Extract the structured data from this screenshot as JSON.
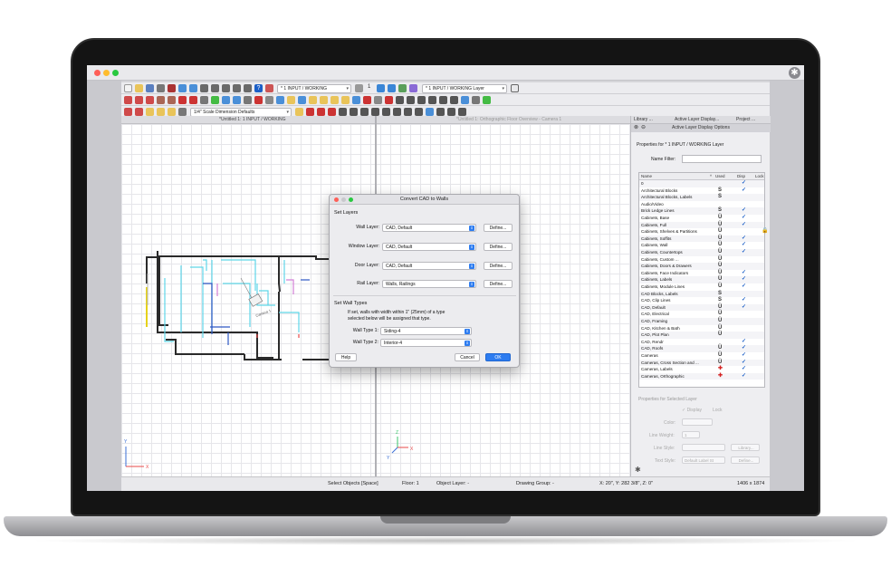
{
  "toolbar": {
    "layer_select": "* 1 INPUT / WORKING",
    "layer_select_count": "1",
    "working_layer_select": "* 1 INPUT / WORKING Layer",
    "dimension_select": "1/4\" Scale Dimension Defaults"
  },
  "document_tabs": {
    "left": "*Untitled 1: 1 INPUT / WORKING",
    "right": "*Untitled 1: Orthographic Floor Overview - Camera 1"
  },
  "floor_plan": {
    "label": "Camera 1"
  },
  "axes": {
    "x": "X",
    "y": "Y",
    "z": "Z"
  },
  "dialog": {
    "title": "Convert CAD to Walls",
    "set_layers_heading": "Set Layers",
    "wall_layer_label": "Wall Layer:",
    "wall_layer_value": "CAD, Default",
    "window_layer_label": "Window Layer:",
    "window_layer_value": "CAD, Default",
    "door_layer_label": "Door Layer:",
    "door_layer_value": "CAD, Default",
    "rail_layer_label": "Rail Layer:",
    "rail_layer_value": "Walls, Railings",
    "define_label": "Define...",
    "set_wall_types_heading": "Set Wall Types",
    "note_line1": "If set, walls with width within 1\" (25mm) of a type",
    "note_line2": "selected below will be assigned that type.",
    "wall_type1_label": "Wall Type 1:",
    "wall_type1_value": "Siding-4",
    "wall_type2_label": "Wall Type 2:",
    "wall_type2_value": "Interior-4",
    "help_label": "Help",
    "cancel_label": "Cancel",
    "ok_label": "OK"
  },
  "panel": {
    "tabs": [
      "Library ...",
      "Active Layer Display...",
      "Project ..."
    ],
    "header": "Active Layer Display Options",
    "properties_for": "Properties for * 1 INPUT / WORKING Layer",
    "name_filter_label": "Name Filter:",
    "columns": {
      "name": "Name",
      "used": "Used",
      "disp": "Disp",
      "lock": "Lock"
    },
    "layers": [
      {
        "name": "0",
        "used": "",
        "disp": "✓"
      },
      {
        "name": "Architectural Blocks",
        "used": "S",
        "disp": "✓"
      },
      {
        "name": "Architectural Blocks, Labels",
        "used": "S",
        "disp": ""
      },
      {
        "name": "Audio/Video",
        "used": "",
        "disp": ""
      },
      {
        "name": "Brick Ledge Lines",
        "used": "S",
        "disp": "✓"
      },
      {
        "name": "Cabinets,  Base",
        "used": "Ü",
        "disp": "✓"
      },
      {
        "name": "Cabinets,  Full",
        "used": "Ü",
        "disp": "✓"
      },
      {
        "name": "Cabinets,  Shelves & Partitions",
        "used": "Ü",
        "disp": ""
      },
      {
        "name": "Cabinets,  Soffits",
        "used": "Ü",
        "disp": "✓"
      },
      {
        "name": "Cabinets,  Wall",
        "used": "Ü",
        "disp": "✓"
      },
      {
        "name": "Cabinets, Countertops",
        "used": "Ü",
        "disp": "✓"
      },
      {
        "name": "Cabinets, Custom ...",
        "used": "Ü",
        "disp": ""
      },
      {
        "name": "Cabinets, Doors & Drawers",
        "used": "Ü",
        "disp": ""
      },
      {
        "name": "Cabinets, Face Indicators",
        "used": "Ü",
        "disp": "✓"
      },
      {
        "name": "Cabinets, Labels",
        "used": "Ü",
        "disp": "✓"
      },
      {
        "name": "Cabinets, Module Lines",
        "used": "Ü",
        "disp": "✓"
      },
      {
        "name": "CAD Blocks, Labels",
        "used": "S",
        "disp": ""
      },
      {
        "name": "CAD, Clip Lines",
        "used": "S",
        "disp": "✓"
      },
      {
        "name": "CAD, Default",
        "used": "Ü",
        "disp": "✓"
      },
      {
        "name": "CAD, Electrical",
        "used": "Ü",
        "disp": ""
      },
      {
        "name": "CAD, Framing",
        "used": "Ü",
        "disp": ""
      },
      {
        "name": "CAD, Kitchen & Bath",
        "used": "Ü",
        "disp": ""
      },
      {
        "name": "CAD, Plot Plan",
        "used": "Ü",
        "disp": ""
      },
      {
        "name": "CAD, Rendr",
        "used": "",
        "disp": "✓"
      },
      {
        "name": "CAD, Roofs",
        "used": "Ü",
        "disp": "✓"
      },
      {
        "name": "Cameras",
        "used": "Ü",
        "disp": "✓"
      },
      {
        "name": "Cameras, Cross Section and ...",
        "used": "Ü",
        "disp": "✓"
      },
      {
        "name": "Cameras, Labels",
        "used": "✚",
        "disp": "✓"
      },
      {
        "name": "Cameras, Orthographic",
        "used": "✚",
        "disp": "✓"
      }
    ],
    "selected_props_title": "Properties for Selected Layer",
    "display_label": "✓ Display",
    "lock_label": "Lock",
    "color_label": "Color:",
    "line_weight_label": "Line Weight:",
    "line_weight_value": "1",
    "line_style_label": "Line Style:",
    "library_label": "Library...",
    "text_style_label": "Text Style:",
    "text_style_value": "Default Label St",
    "define_label": "Define..."
  },
  "status_bar": {
    "mode": "Select Objects [Space]",
    "floor": "Floor: 1",
    "object_layer": "Object Layer: -",
    "drawing_group": "Drawing Group: -",
    "coords": "X: 20\", Y: 282 3/8\", Z: 0\"",
    "size": "1406 x 1874"
  },
  "colors": {
    "accent": "#2d7cf0",
    "cyan_walls": "#5fd6e8",
    "wall_dark": "#2a2a2a",
    "yellow_wall": "#e6d21a",
    "close": "#fe5f57",
    "minimize": "#febc2e",
    "zoom": "#28c840"
  }
}
